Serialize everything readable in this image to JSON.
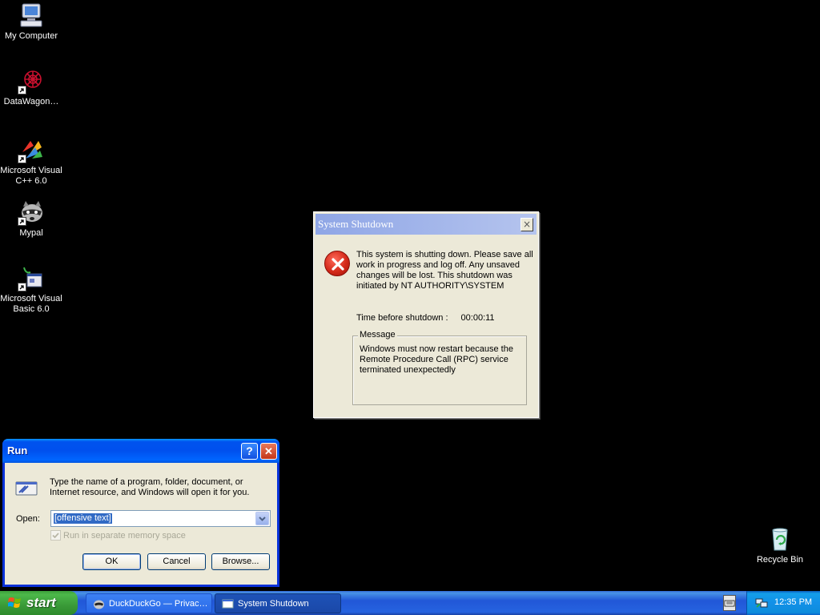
{
  "desktop": {
    "icons": [
      {
        "label": "My Computer",
        "icon": "my-computer-icon"
      },
      {
        "label": "DataWagon…",
        "icon": "datawagon-icon"
      },
      {
        "label": "Microsoft Visual C++ 6.0",
        "icon": "visual-cpp-icon"
      },
      {
        "label": "Mypal",
        "icon": "mypal-raccoon-icon"
      },
      {
        "label": "Microsoft Visual Basic 6.0",
        "icon": "visual-basic-icon"
      },
      {
        "label": "Recycle Bin",
        "icon": "recycle-bin-icon"
      }
    ]
  },
  "shutdown_dialog": {
    "title": "System Shutdown",
    "close_label": "×",
    "message": "This system is shutting down. Please save all work in progress and log off. Any unsaved changes will be lost. This shutdown was initiated by NT AUTHORITY\\SYSTEM",
    "timer_label": "Time before shutdown :",
    "timer_value": "00:00:11",
    "group_label": "Message",
    "group_text": "Windows must now restart because the Remote Procedure Call (RPC) service terminated unexpectedly",
    "icon": "error-icon"
  },
  "run_dialog": {
    "title": "Run",
    "help_label": "?",
    "close_label": "✕",
    "description": "Type the name of a program, folder, document, or Internet resource, and Windows will open it for you.",
    "open_label": "Open:",
    "open_value": "[offensive text]",
    "checkbox_label": "Run in separate memory space",
    "ok_label": "OK",
    "cancel_label": "Cancel",
    "browse_label": "Browse..."
  },
  "taskbar": {
    "start_label": "start",
    "tasks": [
      {
        "label": "DuckDuckGo — Privac…",
        "icon": "mypal-raccoon-icon",
        "active": false
      },
      {
        "label": "System Shutdown",
        "icon": "window-icon",
        "active": true
      }
    ],
    "clock": "12:35 PM"
  },
  "colors": {
    "desktop_bg": "#000000",
    "taskbar_blue": "#245edb",
    "start_green": "#3a9a38",
    "dialog_face": "#ece9d8",
    "xp_title_blue": "#0053ee",
    "selection_blue": "#316ac5"
  }
}
